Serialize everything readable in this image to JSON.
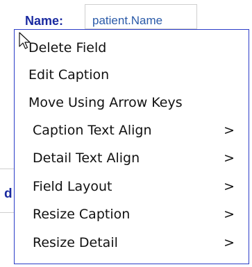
{
  "form": {
    "name_caption": "Name:",
    "name_value": "patient.Name",
    "partial_caption": "d"
  },
  "context_menu": {
    "items": [
      {
        "label": "Delete Field",
        "submenu": false
      },
      {
        "label": "Edit Caption",
        "submenu": false
      },
      {
        "label": "Move Using Arrow Keys",
        "submenu": false
      },
      {
        "label": "Caption Text Align",
        "submenu": true
      },
      {
        "label": "Detail Text Align",
        "submenu": true
      },
      {
        "label": "Field Layout",
        "submenu": true
      },
      {
        "label": "Resize Caption",
        "submenu": true
      },
      {
        "label": "Resize Detail",
        "submenu": true
      }
    ],
    "submenu_indicator": ">"
  },
  "colors": {
    "menu_border": "#2b3cc8",
    "caption_text": "#1a2aa0",
    "detail_text": "#2a5aa8"
  },
  "icons": {
    "cursor": "mouse-pointer-icon"
  }
}
